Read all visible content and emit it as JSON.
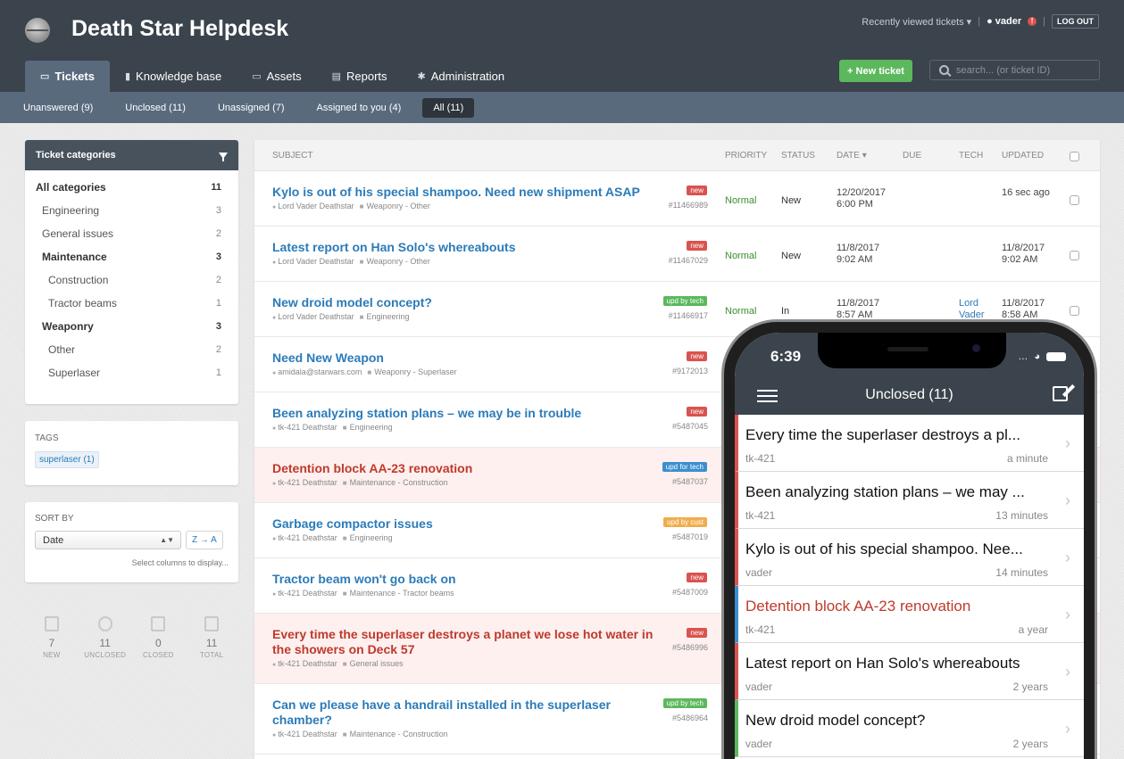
{
  "header": {
    "title": "Death Star Helpdesk",
    "recently_viewed": "Recently viewed tickets ▾",
    "username": "vader",
    "alert": "!",
    "logout": "LOG OUT"
  },
  "nav": {
    "tabs": [
      {
        "label": "Tickets",
        "icon": "inbox-icon"
      },
      {
        "label": "Knowledge base",
        "icon": "book-icon"
      },
      {
        "label": "Assets",
        "icon": "laptop-icon"
      },
      {
        "label": "Reports",
        "icon": "bar-chart-icon"
      },
      {
        "label": "Administration",
        "icon": "gear-icon"
      }
    ],
    "active": "Tickets",
    "new_ticket": "+ New ticket",
    "search_placeholder": "search... (or ticket ID)"
  },
  "subnav": {
    "tabs": [
      "Unanswered (9)",
      "Unclosed (11)",
      "Unassigned (7)",
      "Assigned to you (4)",
      "All (11)"
    ],
    "active": "All (11)"
  },
  "sidebar": {
    "categories_title": "Ticket categories",
    "categories": [
      {
        "label": "All categories",
        "count": "11",
        "bold": true,
        "indent": 0
      },
      {
        "label": "Engineering",
        "count": "3",
        "indent": 1
      },
      {
        "label": "General issues",
        "count": "2",
        "indent": 1
      },
      {
        "label": "Maintenance",
        "count": "3",
        "bold": true,
        "indent": 1
      },
      {
        "label": "Construction",
        "count": "2",
        "indent": 2
      },
      {
        "label": "Tractor beams",
        "count": "1",
        "indent": 2
      },
      {
        "label": "Weaponry",
        "count": "3",
        "bold": true,
        "indent": 1
      },
      {
        "label": "Other",
        "count": "2",
        "indent": 2
      },
      {
        "label": "Superlaser",
        "count": "1",
        "indent": 2
      }
    ],
    "tags_title": "TAGS",
    "tag": "superlaser (1)",
    "sort_title": "SORT BY",
    "sort_value": "Date",
    "sort_order": "Z → A",
    "select_columns": "Select columns to display...",
    "stats": [
      {
        "num": "7",
        "label": "NEW"
      },
      {
        "num": "11",
        "label": "UNCLOSED"
      },
      {
        "num": "0",
        "label": "CLOSED"
      },
      {
        "num": "11",
        "label": "TOTAL"
      }
    ]
  },
  "table": {
    "headers": {
      "subject": "SUBJECT",
      "priority": "PRIORITY",
      "status": "STATUS",
      "date": "DATE ▾",
      "due": "DUE",
      "tech": "TECH",
      "updated": "UPDATED"
    },
    "rows": [
      {
        "subject": "Kylo is out of his special shampoo. Need new shipment ASAP",
        "person": "Lord Vader Deathstar",
        "category": "Weaponry - Other",
        "badge": "new",
        "id": "#11466989",
        "priority": "Normal",
        "status": "New",
        "date": "12/20/2017\n6:00 PM",
        "tech": "",
        "updated": "16 sec ago"
      },
      {
        "subject": "Latest report on Han Solo's whereabouts",
        "person": "Lord Vader Deathstar",
        "category": "Weaponry - Other",
        "badge": "new",
        "id": "#11467029",
        "priority": "Normal",
        "status": "New",
        "date": "11/8/2017\n9:02 AM",
        "tech": "",
        "updated": "11/8/2017\n9:02 AM"
      },
      {
        "subject": "New droid model concept?",
        "person": "Lord Vader Deathstar",
        "category": "Engineering",
        "badge": "upd by tech",
        "id": "#11466917",
        "priority": "Normal",
        "status": "In\nprogress",
        "date": "11/8/2017\n8:57 AM",
        "tech": "Lord\nVader",
        "updated": "11/8/2017\n8:58 AM"
      },
      {
        "subject": "Need New Weapon",
        "person": "amidala@starwars.com",
        "category": "Weaponry - Superlaser",
        "badge": "new",
        "id": "#9172013"
      },
      {
        "subject": "Been analyzing station plans – we may be in trouble",
        "person": "tk-421 Deathstar",
        "category": "Engineering",
        "badge": "new",
        "id": "#5487045"
      },
      {
        "subject": "Detention block AA-23 renovation",
        "person": "tk-421 Deathstar",
        "category": "Maintenance - Construction",
        "badge": "upd for tech",
        "id": "#5487037"
      },
      {
        "subject": "Garbage compactor issues",
        "person": "tk-421 Deathstar",
        "category": "Engineering",
        "badge": "upd by cust",
        "id": "#5487019"
      },
      {
        "subject": "Tractor beam won't go back on",
        "person": "tk-421 Deathstar",
        "category": "Maintenance - Tractor beams",
        "badge": "new",
        "id": "#5487009"
      },
      {
        "subject": "Every time the superlaser destroys a planet we lose hot water in the showers on Deck 57",
        "person": "tk-421 Deathstar",
        "category": "General issues",
        "badge": "new",
        "id": "#5486996"
      },
      {
        "subject": "Can we please have a handrail installed in the superlaser chamber?",
        "person": "tk-421 Deathstar",
        "category": "Maintenance - Construction",
        "badge": "upd by tech",
        "id": "#5486964"
      }
    ]
  },
  "phone": {
    "time": "6:39",
    "title": "Unclosed (11)",
    "items": [
      {
        "title": "Every time the superlaser destroys a pl...",
        "by": "tk-421",
        "when": "a minute"
      },
      {
        "title": "Been analyzing station plans – we may ...",
        "by": "tk-421",
        "when": "13 minutes"
      },
      {
        "title": "Kylo is out of his special shampoo. Nee...",
        "by": "vader",
        "when": "14 minutes"
      },
      {
        "title": "Detention block AA-23 renovation",
        "by": "tk-421",
        "when": "a year"
      },
      {
        "title": "Latest report on Han Solo's whereabouts",
        "by": "vader",
        "when": "2 years"
      },
      {
        "title": "New droid model concept?",
        "by": "vader",
        "when": "2 years"
      }
    ]
  }
}
